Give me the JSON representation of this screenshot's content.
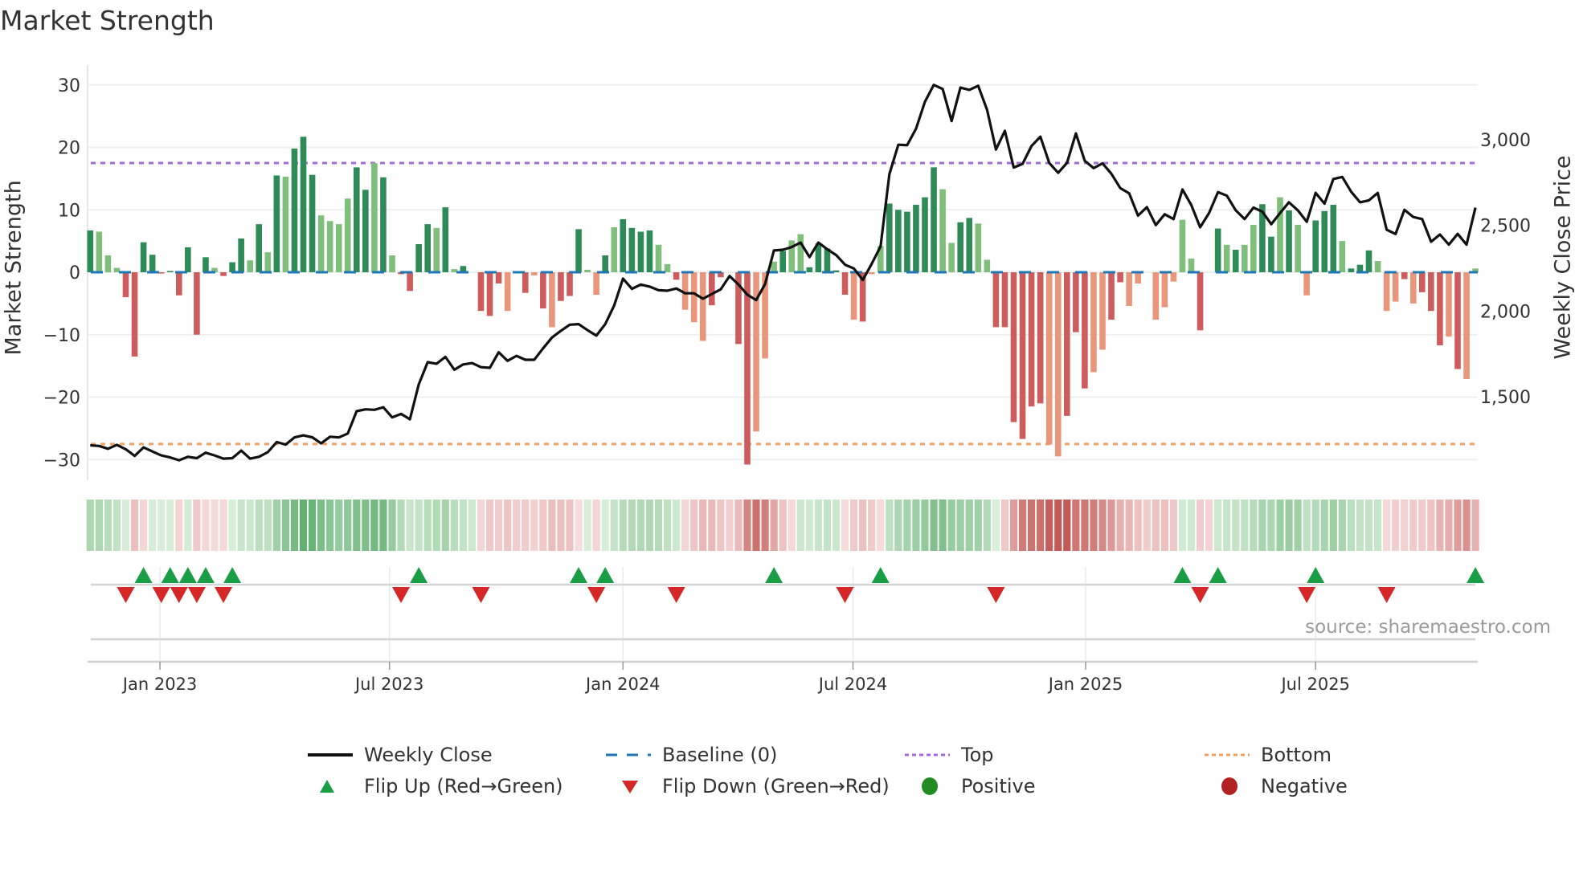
{
  "title": "Market Strength",
  "source": "source: sharemaestro.com",
  "chart_data": {
    "type": "bar",
    "title": "Market Strength",
    "ylabel": "Market Strength",
    "y2label": "Weekly Close Price",
    "ylim": [
      -33,
      33
    ],
    "y2lim": [
      1100,
      3400
    ],
    "yticks": [
      -30,
      -20,
      -10,
      0,
      10,
      20,
      30
    ],
    "ytick_labels": [
      "−30",
      "−20",
      "−10",
      "0",
      "10",
      "20",
      "30"
    ],
    "y2ticks": [
      1500,
      2000,
      2500,
      3000
    ],
    "y2tick_labels": [
      "1,500",
      "2,000",
      "2,500",
      "3,000"
    ],
    "xticks_week": [
      7.85,
      33.7,
      60.0,
      85.9,
      112.1,
      138.0
    ],
    "xtick_labels": [
      "Jan 2023",
      "Jul 2023",
      "Jan 2024",
      "Jul 2024",
      "Jan 2025",
      "Jul 2025"
    ],
    "top_level": 17.5,
    "bottom_level": -27.5,
    "baseline": 0,
    "strength": [
      6.7,
      6.5,
      2.7,
      0.7,
      -4.0,
      -13.5,
      4.8,
      2.8,
      -0.2,
      0.2,
      -3.7,
      4.0,
      -10.0,
      2.4,
      0.7,
      -0.6,
      1.6,
      5.4,
      1.9,
      7.7,
      3.2,
      15.5,
      15.3,
      19.8,
      21.7,
      15.6,
      9.1,
      8.2,
      7.7,
      11.8,
      16.8,
      13.2,
      17.5,
      15.2,
      2.7,
      -0.3,
      -3.0,
      4.5,
      7.7,
      7.1,
      10.4,
      0.5,
      1.0,
      0,
      -6.2,
      -7.0,
      -1.8,
      -6.2,
      0,
      -3.3,
      -0.5,
      -5.8,
      -8.8,
      -4.6,
      -3.8,
      6.9,
      0.4,
      -3.6,
      2.7,
      7.2,
      8.5,
      7.1,
      6.5,
      6.7,
      4.4,
      1.3,
      -1.2,
      -6.0,
      -8.0,
      -11.0,
      -5.3,
      -0.8,
      0,
      -11.5,
      -30.8,
      -25.5,
      -13.8,
      1.7,
      3.4,
      5.1,
      6.1,
      0.8,
      4.6,
      3.8,
      0.3,
      -3.6,
      -7.6,
      -7.9,
      -0.3,
      4.2,
      11.0,
      10.0,
      9.7,
      10.8,
      12.0,
      16.8,
      13.3,
      4.7,
      8.0,
      8.7,
      7.8,
      2.0,
      -8.8,
      -8.8,
      -24.0,
      -26.7,
      -21.5,
      -21.0,
      -27.6,
      -29.5,
      -23.0,
      -9.6,
      -18.6,
      -16.0,
      -12.4,
      -7.6,
      -1.6,
      -5.4,
      -1.8,
      0,
      -7.6,
      -5.6,
      -1.5,
      8.4,
      2.2,
      -9.3,
      0,
      7.0,
      4.4,
      3.6,
      4.4,
      7.6,
      10.9,
      5.7,
      12.0,
      9.9,
      7.6,
      -3.7,
      8.3,
      9.8,
      10.8,
      5.0,
      0.6,
      1.2,
      3.5,
      1.8,
      -6.2,
      -4.7,
      -1.1,
      -5.0,
      -3.2,
      -6.2,
      -11.7,
      -10.3,
      -15.5,
      -17.1,
      0.6
    ],
    "shade": "dlllddddddddddldddldldldddllllddldlddddldldsdddlddsdldddlldlddddlldllldddddllsdlldddddldllddddddllddllddddddlldddllddlldllllldldsdllddsdlldddldddllldldddldllldldddldddd",
    "weekly_close": [
      1217,
      1213,
      1197,
      1220,
      1194,
      1155,
      1205,
      1181,
      1158,
      1146,
      1130,
      1150,
      1142,
      1174,
      1158,
      1139,
      1142,
      1186,
      1139,
      1150,
      1177,
      1236,
      1221,
      1263,
      1275,
      1264,
      1228,
      1267,
      1263,
      1286,
      1416,
      1427,
      1424,
      1439,
      1380,
      1400,
      1369,
      1572,
      1702,
      1693,
      1733,
      1658,
      1689,
      1697,
      1673,
      1669,
      1760,
      1710,
      1739,
      1716,
      1716,
      1783,
      1846,
      1885,
      1921,
      1924,
      1889,
      1857,
      1924,
      2033,
      2190,
      2130,
      2155,
      2143,
      2122,
      2119,
      2132,
      2104,
      2104,
      2072,
      2100,
      2127,
      2205,
      2155,
      2096,
      2064,
      2158,
      2354,
      2358,
      2374,
      2400,
      2315,
      2400,
      2361,
      2327,
      2271,
      2249,
      2182,
      2275,
      2377,
      2799,
      2971,
      2968,
      3065,
      3221,
      3320,
      3296,
      3109,
      3304,
      3291,
      3315,
      3174,
      2943,
      3052,
      2838,
      2859,
      2963,
      3018,
      2865,
      2807,
      2865,
      3037,
      2877,
      2834,
      2862,
      2802,
      2718,
      2687,
      2557,
      2607,
      2502,
      2565,
      2537,
      2710,
      2619,
      2489,
      2572,
      2694,
      2674,
      2588,
      2537,
      2604,
      2580,
      2507,
      2572,
      2635,
      2588,
      2521,
      2690,
      2627,
      2771,
      2783,
      2697,
      2635,
      2646,
      2690,
      2475,
      2450,
      2591,
      2549,
      2537,
      2405,
      2447,
      2388,
      2451,
      2388,
      2604
    ],
    "flip_up_weeks": [
      6,
      9,
      11,
      13,
      16,
      37,
      55,
      58,
      77,
      89,
      123,
      127,
      138,
      156
    ],
    "flip_down_weeks": [
      4,
      8,
      10,
      12,
      15,
      35,
      44,
      57,
      66,
      85,
      102,
      125,
      137,
      146
    ],
    "colors": {
      "pos_dark": "#2e8b57",
      "pos_light": "#7fbf7b",
      "neg_dark": "#cd5c5c",
      "neg_light": "#e9967a",
      "line": "#111111",
      "baseline": "#1f77b4",
      "top": "#a569e0",
      "bottom": "#f0a060",
      "flip_up": "#1a9e45",
      "flip_down": "#d62728",
      "positive": "#228b22",
      "negative": "#b22222"
    },
    "legend": {
      "placement": "bottom",
      "items": [
        {
          "label": "Weekly Close",
          "icon": "solid-line"
        },
        {
          "label": "Baseline (0)",
          "icon": "dashed-line"
        },
        {
          "label": "Top",
          "icon": "dotted-line"
        },
        {
          "label": "Bottom",
          "icon": "dotted-line"
        },
        {
          "label": "Flip Up (Red→Green)",
          "icon": "triangle-up"
        },
        {
          "label": "Flip Down (Green→Red)",
          "icon": "triangle-down"
        },
        {
          "label": "Positive",
          "icon": "circle"
        },
        {
          "label": "Negative",
          "icon": "circle"
        }
      ]
    }
  }
}
